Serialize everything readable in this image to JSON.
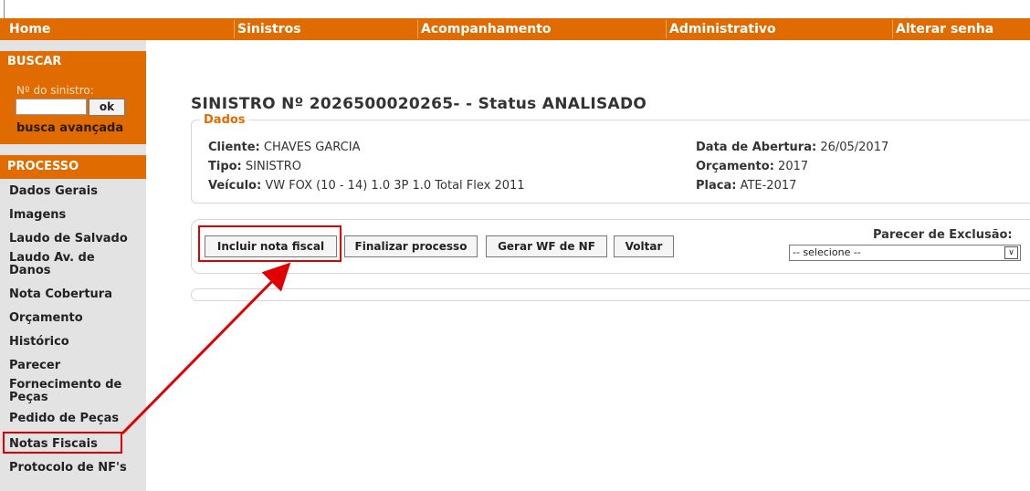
{
  "topnav": {
    "items": [
      "Home",
      "Sinistros",
      "Acompanhamento",
      "Administrativo",
      "Alterar senha"
    ]
  },
  "sidebar": {
    "busca_title": "BUSCAR",
    "busca_label": "Nº do sinistro:",
    "busca_value": "",
    "ok_label": "ok",
    "advanced_link": "busca avançada",
    "processo_title": "PROCESSO",
    "menu": [
      "Dados Gerais",
      "Imagens",
      "Laudo de Salvado",
      "Laudo Av. de Danos",
      "Nota Cobertura",
      "Orçamento",
      "Histórico",
      "Parecer",
      "Fornecimento de Peças",
      "Pedido de Peças",
      "Notas Fiscais",
      "Protocolo de NF's"
    ]
  },
  "main": {
    "title": "SINISTRO Nº  2026500020265-  -  Status  ANALISADO",
    "legend": "Dados",
    "cliente_label": "Cliente:",
    "cliente_value": "CHAVES GARCIA",
    "tipo_label": "Tipo:",
    "tipo_value": "SINISTRO",
    "veiculo_label": "Veículo:",
    "veiculo_value": "VW FOX (10 - 14) 1.0 3P 1.0 Total Flex 2011",
    "abertura_label": "Data de Abertura:",
    "abertura_value": "26/05/2017",
    "orcamento_label": "Orçamento:",
    "orcamento_value": "2017",
    "placa_label": "Placa:",
    "placa_value": "ATE-2017",
    "buttons": {
      "incluir": "Incluir nota fiscal",
      "finalizar": "Finalizar processo",
      "gerar": "Gerar WF de NF",
      "voltar": "Voltar"
    },
    "parecer_label": "Parecer de Exclusão:",
    "parecer_selected": "-- selecione --"
  },
  "colors": {
    "brand_orange": "#e06b00",
    "sidebar_bg": "#e3e3e3",
    "annotation_red": "#e00000"
  }
}
